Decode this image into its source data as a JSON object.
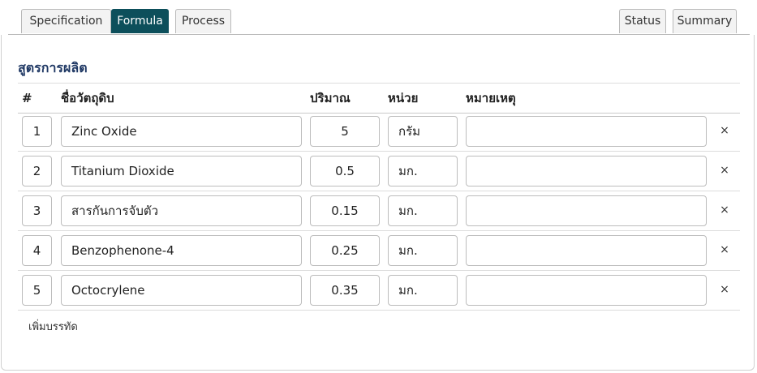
{
  "tabs_left": [
    {
      "label": "Specification",
      "active": false
    },
    {
      "label": "Formula",
      "active": true
    },
    {
      "label": "Process",
      "active": false
    }
  ],
  "tabs_right": [
    {
      "label": "Status"
    },
    {
      "label": "Summary"
    }
  ],
  "section_title": "สูตรการผลิต",
  "table": {
    "headers": {
      "num": "#",
      "name": "ชื่อวัตถุดิบ",
      "qty": "ปริมาณ",
      "unit": "หน่วย",
      "note": "หมายเหตุ"
    },
    "rows": [
      {
        "num": "1",
        "name": "Zinc Oxide",
        "qty": "5",
        "unit": "กรัม",
        "note": ""
      },
      {
        "num": "2",
        "name": "Titanium Dioxide",
        "qty": "0.5",
        "unit": "มก.",
        "note": ""
      },
      {
        "num": "3",
        "name": "สารกันการจับตัว",
        "qty": "0.15",
        "unit": "มก.",
        "note": ""
      },
      {
        "num": "4",
        "name": "Benzophenone-4",
        "qty": "0.25",
        "unit": "มก.",
        "note": ""
      },
      {
        "num": "5",
        "name": "Octocrylene",
        "qty": "0.35",
        "unit": "มก.",
        "note": ""
      }
    ],
    "delete_label": "×"
  },
  "add_row_label": "เพิ่มบรรทัด",
  "colors": {
    "active_tab": "#0d4f5b",
    "section_title": "#1f3864"
  }
}
